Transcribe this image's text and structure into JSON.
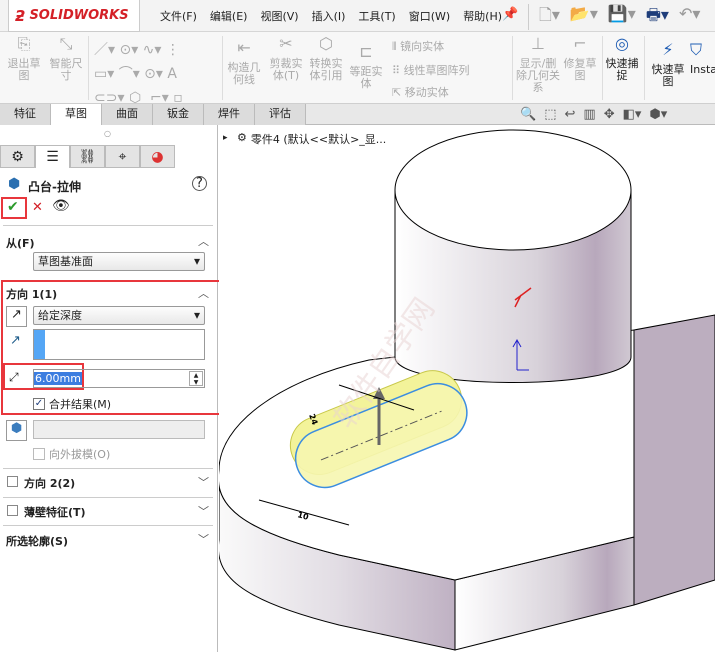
{
  "app": {
    "brand": "SOLIDWORKS"
  },
  "menu": [
    "文件(F)",
    "编辑(E)",
    "视图(V)",
    "插入(I)",
    "工具(T)",
    "窗口(W)",
    "帮助(H)"
  ],
  "toolbar": {
    "exit_sketch": "退出草图",
    "smart_dim": "智能尺寸",
    "construction": "构造几何线",
    "trim": "剪裁实体(T)",
    "convert": "转换实体引用",
    "offset": "等距实体",
    "mirror": "镜向实体",
    "linear_pattern": "线性草图阵列",
    "move": "移动实体",
    "relations": "显示/删除几何关系",
    "repair": "修复草图",
    "quick_snap": "快速捕捉",
    "rapid_sketch": "快速草图",
    "instant": "Insta"
  },
  "tabs": [
    "特征",
    "草图",
    "曲面",
    "钣金",
    "焊件",
    "评估"
  ],
  "active_tab": "草图",
  "panel": {
    "title": "凸台-拉伸",
    "from_label": "从(F)",
    "from_value": "草图基准面",
    "dir1_label": "方向 1(1)",
    "dir1_type": "给定深度",
    "depth": "6.00mm",
    "merge_label": "合并结果(M)",
    "merge_checked": true,
    "draft_label": "向外拔模(O)",
    "dir2_label": "方向 2(2)",
    "thin_label": "薄壁特征(T)",
    "contours_label": "所选轮廓(S)"
  },
  "tree": {
    "part": "零件4 (默认<<默认>_显..."
  },
  "model": {
    "dim1": "10",
    "dim2": "24"
  },
  "watermark": "软件自学网 RJZXW.COM",
  "colors": {
    "accent": "#1e5cb3",
    "highlight": "#e8363c",
    "boss": "#f3f39a"
  }
}
